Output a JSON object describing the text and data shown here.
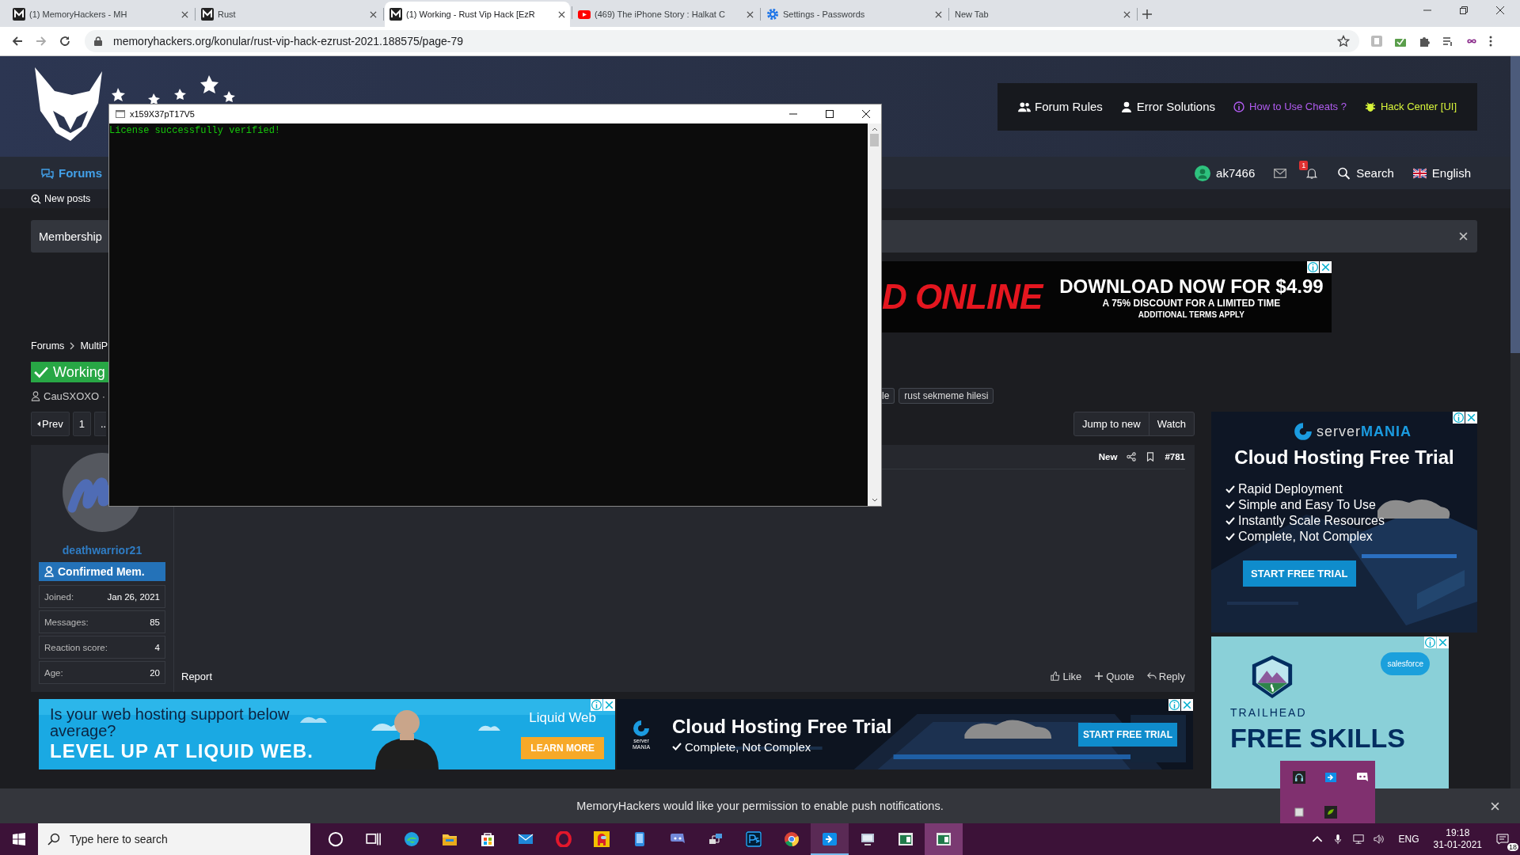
{
  "browser": {
    "tabs": [
      {
        "title": "(1) MemoryHackers - MH",
        "kind": "site",
        "selected": false
      },
      {
        "title": "Rust",
        "kind": "site",
        "selected": false
      },
      {
        "title": "(1) Working - Rust Vip Hack [EzR",
        "kind": "site",
        "selected": true
      },
      {
        "title": "(469) The iPhone Story : Halkat C",
        "kind": "video",
        "selected": false
      },
      {
        "title": "Settings - Passwords",
        "kind": "settings",
        "selected": false
      },
      {
        "title": "New Tab",
        "kind": "blank",
        "selected": false
      }
    ],
    "url": "memoryhackers.org/konular/rust-vip-hack-ezrust-2021.188575/page-79"
  },
  "header": {
    "links": [
      {
        "label": "Forum Rules",
        "kind": "rules",
        "color": "#ffffff"
      },
      {
        "label": "Error Solutions",
        "kind": "solutions",
        "color": "#ffffff"
      },
      {
        "label": "How to Use Cheats ?",
        "kind": "help",
        "color": "#b15cf0"
      },
      {
        "label": "Hack Center [UI]",
        "kind": "hack",
        "color": "#d8f53a"
      }
    ]
  },
  "nav": {
    "tabs": [
      {
        "label": "Forums",
        "selected": true
      }
    ],
    "username": "ak7466",
    "alerts": "1",
    "search": "Search",
    "language": "English"
  },
  "subnav": {
    "items": [
      "New posts"
    ]
  },
  "notice": {
    "text": "Membership"
  },
  "top_ad": {
    "brand": "D ONLINE",
    "headline": "DOWNLOAD NOW FOR $4.99",
    "offer": "A 75% DISCOUNT FOR A LIMITED TIME",
    "terms": "ADDITIONAL TERMS APPLY"
  },
  "breadcrumb": [
    "Forums",
    "MultiP"
  ],
  "thread": {
    "prefix": "Working",
    "author": "CauSXOXO ·",
    "tags": [
      "le",
      "rust sekmeme hilesi"
    ]
  },
  "pagination": {
    "prev": "Prev",
    "pages": [
      "1",
      ".."
    ]
  },
  "thread_actions": [
    "Jump to new",
    "Watch"
  ],
  "post": {
    "user": {
      "name": "deathwarrior21",
      "title": "Confirmed Mem.",
      "stats": [
        {
          "label": "Joined:",
          "value": "Jan 26, 2021"
        },
        {
          "label": "Messages:",
          "value": "85"
        },
        {
          "label": "Reaction score:",
          "value": "4"
        },
        {
          "label": "Age:",
          "value": "20"
        }
      ]
    },
    "status": "New",
    "number": "#781",
    "report": "Report",
    "actions": [
      {
        "label": "Like",
        "kind": "like"
      },
      {
        "label": "Quote",
        "kind": "quote"
      },
      {
        "label": "Reply",
        "kind": "reply"
      }
    ]
  },
  "liquid_ad": {
    "question": "Is your web hosting support below average?",
    "slogan": "LEVEL UP AT LIQUID WEB.",
    "brand": "Liquid Web",
    "button": "LEARN MORE"
  },
  "banner_ad": {
    "logo": [
      "server",
      "MANIA"
    ],
    "headline": "Cloud Hosting Free Trial",
    "feature": "Complete, Not Complex",
    "button": "START FREE TRIAL"
  },
  "side_ad": {
    "logo": "server**MANIA**",
    "headline": "Cloud Hosting Free Trial",
    "features": [
      "Rapid Deployment",
      "Simple and Easy To Use",
      "Instantly Scale Resources",
      "Complete, Not Complex"
    ],
    "button": "START FREE TRIAL"
  },
  "trail_ad": {
    "partner": "salesforce",
    "brand": "TRAILHEAD",
    "headline": "FREE SKILLS"
  },
  "console": {
    "title": "x159X37pT17V5",
    "output": "License successfully verified!"
  },
  "push_notice": {
    "text": "MemoryHackers would like your permission to enable push notifications."
  },
  "taskbar": {
    "search_placeholder": "Type here to search",
    "language": "ENG",
    "time": "19:18",
    "date": "31-01-2021",
    "notifications": "18"
  }
}
